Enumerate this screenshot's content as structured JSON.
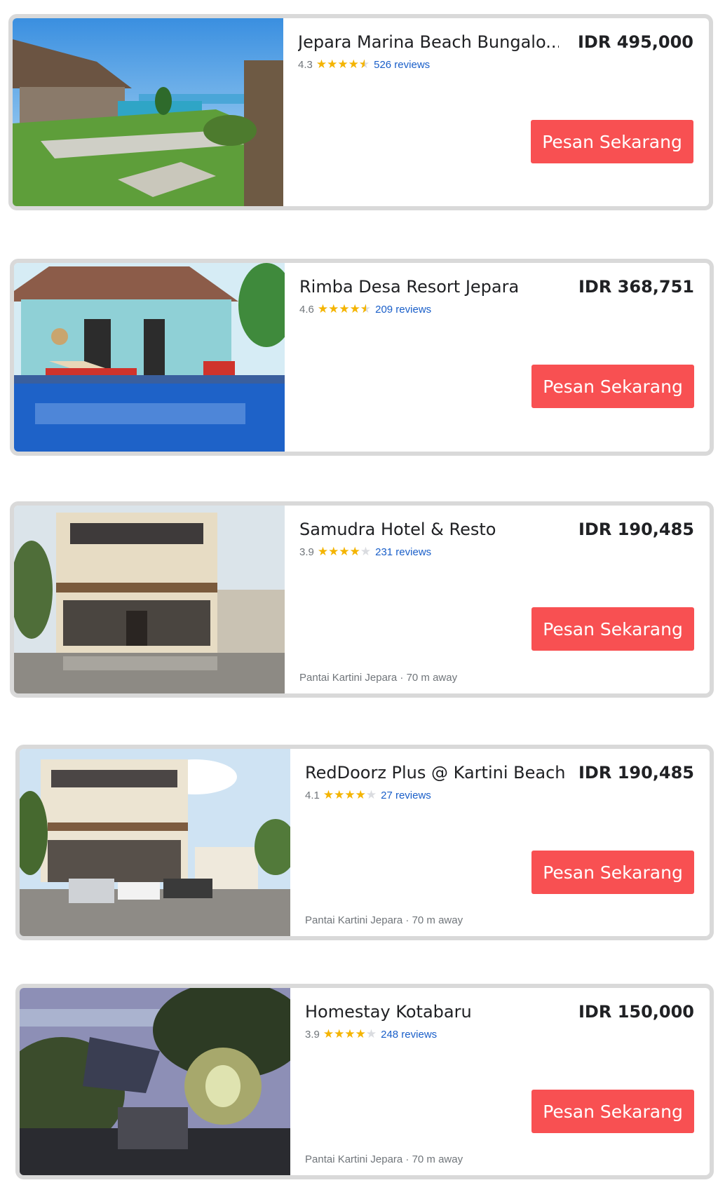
{
  "listings": [
    {
      "name": "Jepara Marina Beach Bungalo...",
      "price": "IDR 495,000",
      "rating": "4.3",
      "stars": 4.3,
      "reviews": "526 reviews",
      "button": "Pesan Sekarang",
      "distance": "",
      "image_icon": "beach-bungalow-photo"
    },
    {
      "name": "Rimba Desa Resort Jepara",
      "price": "IDR 368,751",
      "rating": "4.6",
      "stars": 4.6,
      "reviews": "209 reviews",
      "button": "Pesan Sekarang",
      "distance": "",
      "image_icon": "resort-pool-photo"
    },
    {
      "name": "Samudra Hotel & Resto",
      "price": "IDR 190,485",
      "rating": "3.9",
      "stars": 3.9,
      "reviews": "231 reviews",
      "button": "Pesan Sekarang",
      "distance": "Pantai Kartini Jepara · 70 m away",
      "image_icon": "hotel-facade-photo"
    },
    {
      "name": "RedDoorz Plus @ Kartini Beach...",
      "price": "IDR 190,485",
      "rating": "4.1",
      "stars": 4.1,
      "reviews": "27 reviews",
      "button": "Pesan Sekarang",
      "distance": "Pantai Kartini Jepara · 70 m away",
      "image_icon": "hotel-parking-photo"
    },
    {
      "name": "Homestay Kotabaru",
      "price": "IDR 150,000",
      "rating": "3.9",
      "stars": 3.9,
      "reviews": "248 reviews",
      "button": "Pesan Sekarang",
      "distance": "Pantai Kartini Jepara · 70 m away",
      "image_icon": "homestay-garden-photo"
    }
  ],
  "colors": {
    "button": "#f85052",
    "star": "#f4b400",
    "link": "#1a5fc9",
    "border": "#d9d9d9"
  }
}
